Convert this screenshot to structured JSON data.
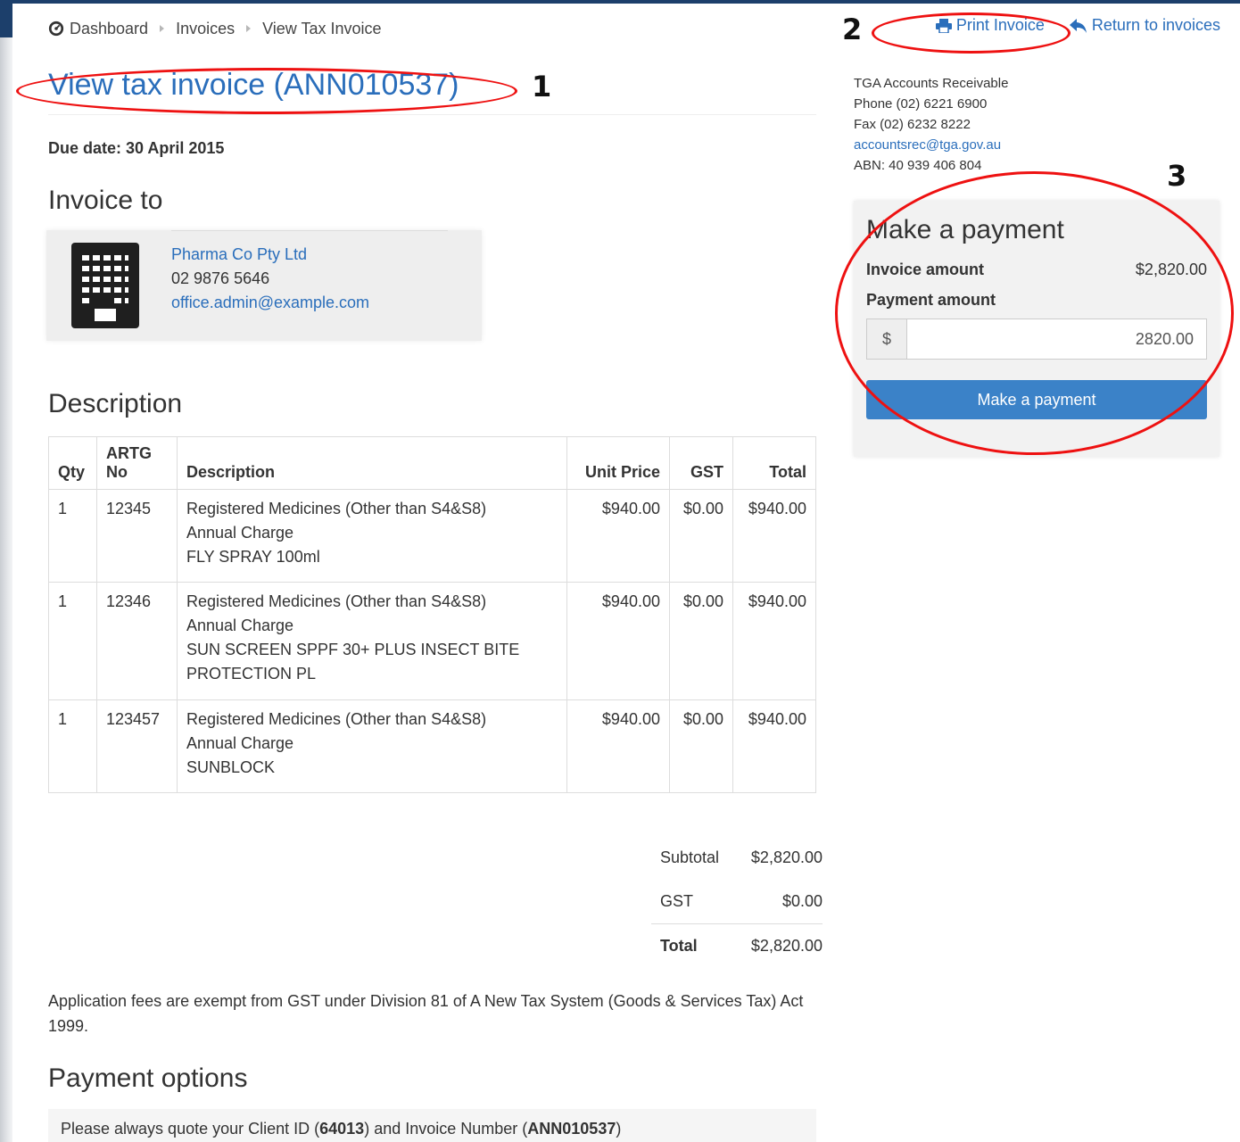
{
  "breadcrumb": [
    {
      "label": "Dashboard"
    },
    {
      "label": "Invoices"
    },
    {
      "label": "View Tax Invoice"
    }
  ],
  "actions": {
    "print_label": "Print Invoice",
    "return_label": "Return to invoices"
  },
  "annotations": {
    "one": "1",
    "two": "2",
    "three": "3"
  },
  "page": {
    "title": "View tax invoice (ANN010537)",
    "due_date": "Due date: 30 April 2015"
  },
  "invoice_to": {
    "heading": "Invoice to",
    "company": "Pharma Co Pty Ltd",
    "phone": "02 9876 5646",
    "email": "office.admin@example.com"
  },
  "description": {
    "heading": "Description",
    "columns": {
      "qty": "Qty",
      "artg_top": "ARTG",
      "artg_bottom": "No",
      "description": "Description",
      "unit_price": "Unit Price",
      "gst": "GST",
      "total": "Total"
    },
    "rows": [
      {
        "qty": "1",
        "artg": "12345",
        "desc1": "Registered Medicines (Other than S4&S8)",
        "desc2": "Annual Charge",
        "desc3": "FLY SPRAY 100ml",
        "unit_price": "$940.00",
        "gst": "$0.00",
        "total": "$940.00"
      },
      {
        "qty": "1",
        "artg": "12346",
        "desc1": "Registered Medicines (Other than S4&S8)",
        "desc2": "Annual Charge",
        "desc3": "SUN SCREEN SPPF 30+ PLUS INSECT BITE PROTECTION PL",
        "unit_price": "$940.00",
        "gst": "$0.00",
        "total": "$940.00"
      },
      {
        "qty": "1",
        "artg": "123457",
        "desc1": "Registered Medicines (Other than S4&S8)",
        "desc2": "Annual Charge",
        "desc3": "SUNBLOCK",
        "unit_price": "$940.00",
        "gst": "$0.00",
        "total": "$940.00"
      }
    ]
  },
  "totals": {
    "subtotal_label": "Subtotal",
    "subtotal": "$2,820.00",
    "gst_label": "GST",
    "gst": "$0.00",
    "total_label": "Total",
    "total": "$2,820.00"
  },
  "gst_note": "Application fees are exempt from GST under Division 81 of A New Tax System (Goods & Services Tax) Act 1999.",
  "payment_options": {
    "heading": "Payment options",
    "quote_prefix": "Please always quote your Client ID (",
    "client_id": "64013",
    "quote_mid": ") and Invoice Number (",
    "invoice_number": "ANN010537",
    "quote_suffix": ")"
  },
  "contact": {
    "name": "TGA Accounts Receivable",
    "phone": "Phone (02) 6221 6900",
    "fax": "Fax (02) 6232 8222",
    "email": "accountsrec@tga.gov.au",
    "abn": "ABN: 40 939 406 804"
  },
  "payment": {
    "heading": "Make a payment",
    "invoice_amount_label": "Invoice amount",
    "invoice_amount": "$2,820.00",
    "payment_amount_label": "Payment amount",
    "currency_symbol": "$",
    "payment_amount_value": "2820.00",
    "button_label": "Make a payment"
  },
  "colors": {
    "link": "#2a6ebb",
    "button": "#3b82c8",
    "annotation": "#e11111"
  }
}
